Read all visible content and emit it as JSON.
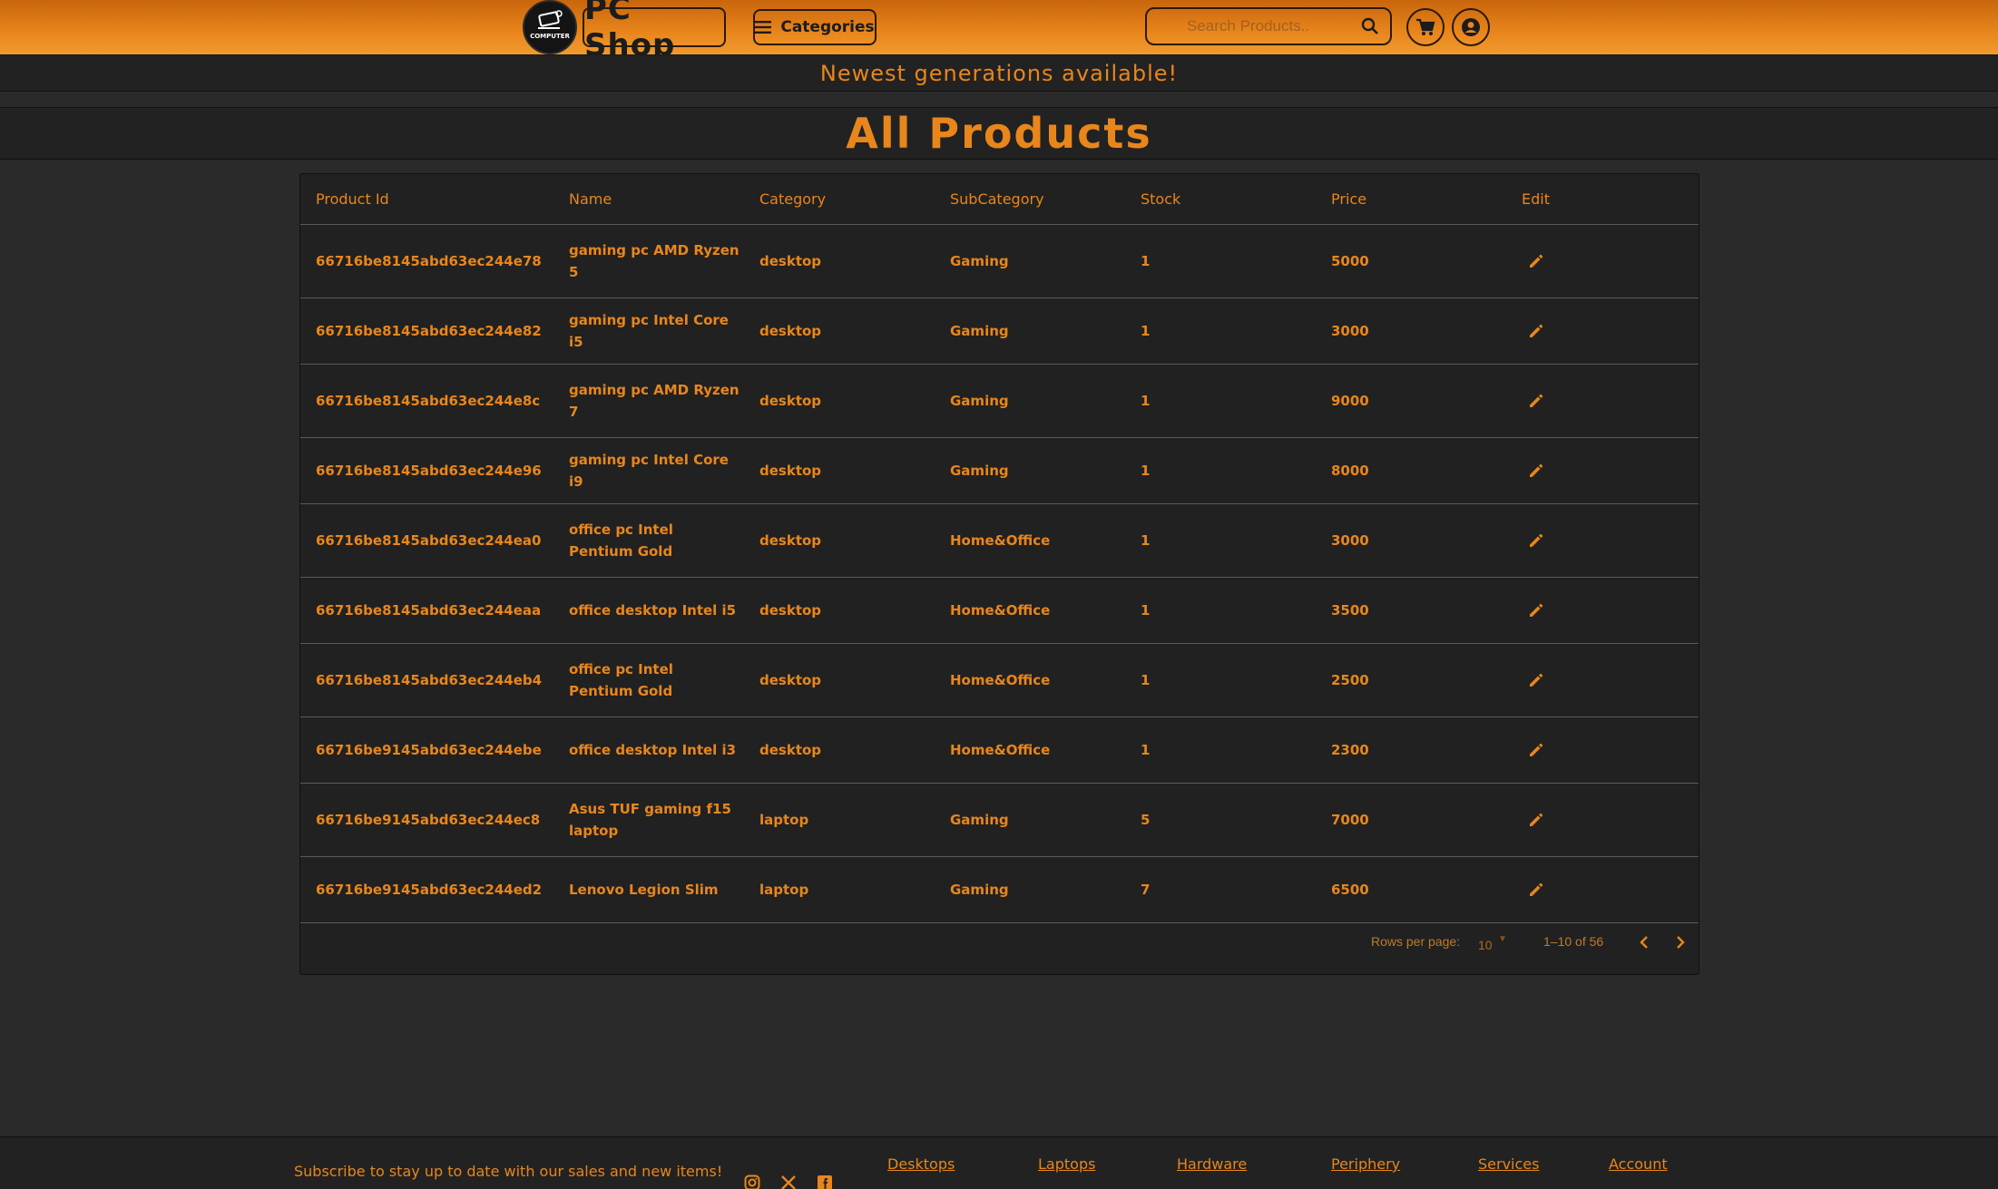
{
  "header": {
    "brand": "PC Shop",
    "logo_text": "COMPUTER",
    "categories_label": "Categories",
    "search_placeholder": "Search Products..",
    "icons": [
      "menu-icon",
      "search-icon",
      "cart-icon",
      "account-icon"
    ]
  },
  "banner": {
    "text": "Newest generations available!"
  },
  "page": {
    "title": "All Products"
  },
  "table": {
    "columns": [
      "Product Id",
      "Name",
      "Category",
      "SubCategory",
      "Stock",
      "Price",
      "Edit"
    ],
    "rows": [
      {
        "id": "66716be8145abd63ec244e78",
        "name": "gaming pc AMD Ryzen 5",
        "category": "desktop",
        "subcategory": "Gaming",
        "stock": "1",
        "price": "5000"
      },
      {
        "id": "66716be8145abd63ec244e82",
        "name": "gaming pc Intel Core i5",
        "category": "desktop",
        "subcategory": "Gaming",
        "stock": "1",
        "price": "3000"
      },
      {
        "id": "66716be8145abd63ec244e8c",
        "name": "gaming pc AMD Ryzen 7",
        "category": "desktop",
        "subcategory": "Gaming",
        "stock": "1",
        "price": "9000"
      },
      {
        "id": "66716be8145abd63ec244e96",
        "name": "gaming pc Intel Core i9",
        "category": "desktop",
        "subcategory": "Gaming",
        "stock": "1",
        "price": "8000"
      },
      {
        "id": "66716be8145abd63ec244ea0",
        "name": "office pc Intel Pentium Gold",
        "category": "desktop",
        "subcategory": "Home&Office",
        "stock": "1",
        "price": "3000"
      },
      {
        "id": "66716be8145abd63ec244eaa",
        "name": "office desktop Intel i5",
        "category": "desktop",
        "subcategory": "Home&Office",
        "stock": "1",
        "price": "3500"
      },
      {
        "id": "66716be8145abd63ec244eb4",
        "name": "office pc Intel Pentium Gold",
        "category": "desktop",
        "subcategory": "Home&Office",
        "stock": "1",
        "price": "2500"
      },
      {
        "id": "66716be9145abd63ec244ebe",
        "name": "office desktop Intel i3",
        "category": "desktop",
        "subcategory": "Home&Office",
        "stock": "1",
        "price": "2300"
      },
      {
        "id": "66716be9145abd63ec244ec8",
        "name": "Asus TUF gaming f15 laptop",
        "category": "laptop",
        "subcategory": "Gaming",
        "stock": "5",
        "price": "7000"
      },
      {
        "id": "66716be9145abd63ec244ed2",
        "name": "Lenovo Legion Slim",
        "category": "laptop",
        "subcategory": "Gaming",
        "stock": "7",
        "price": "6500"
      }
    ]
  },
  "pagination": {
    "rows_per_page_label": "Rows per page:",
    "rows_per_page_value": "10",
    "range_text": "1–10 of 56"
  },
  "footer": {
    "subscribe_text": "Subscribe to stay up to date with our sales and new items!",
    "social_icons": [
      "instagram-icon",
      "x-icon",
      "facebook-icon"
    ],
    "links": [
      "Desktops",
      "Laptops",
      "Hardware",
      "Periphery",
      "Services",
      "Account"
    ]
  },
  "colors": {
    "accent": "#e8861c",
    "header_gradient_top": "#c9650c",
    "background": "#2a2a2a",
    "panel": "#212121"
  }
}
